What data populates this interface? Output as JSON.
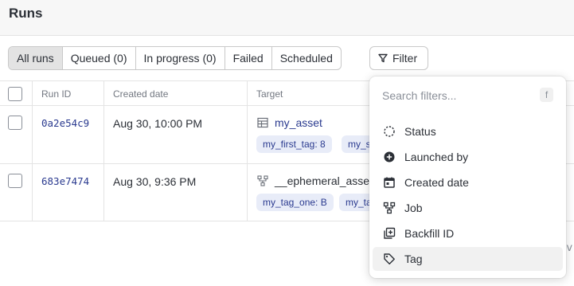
{
  "page": {
    "title": "Runs"
  },
  "tabs": [
    {
      "label": "All runs",
      "active": true
    },
    {
      "label": "Queued (0)",
      "active": false
    },
    {
      "label": "In progress (0)",
      "active": false
    },
    {
      "label": "Failed",
      "active": false
    },
    {
      "label": "Scheduled",
      "active": false
    }
  ],
  "filter_button": {
    "label": "Filter",
    "icon": "funnel-icon"
  },
  "table": {
    "columns": [
      "Run ID",
      "Created date",
      "Target"
    ],
    "rows": [
      {
        "run_id": "0a2e54c9",
        "created": "Aug 30, 10:00 PM",
        "target_icon": "table-icon",
        "target": "my_asset",
        "tags": [
          "my_first_tag: 8",
          "my_second_tag"
        ]
      },
      {
        "run_id": "683e7474",
        "created": "Aug 30, 9:36 PM",
        "target_icon": "job-icon",
        "target": "__ephemeral_asset_job__",
        "tags": [
          "my_tag_one: B",
          "my_tag_two"
        ]
      }
    ],
    "partial_text": "ev"
  },
  "filter_menu": {
    "search_placeholder": "Search filters...",
    "shortcut": "f",
    "items": [
      {
        "label": "Status",
        "icon": "status-dashed-circle-icon"
      },
      {
        "label": "Launched by",
        "icon": "plus-circle-icon"
      },
      {
        "label": "Created date",
        "icon": "calendar-icon"
      },
      {
        "label": "Job",
        "icon": "job-icon"
      },
      {
        "label": "Backfill ID",
        "icon": "backfill-icon"
      },
      {
        "label": "Tag",
        "icon": "tag-icon",
        "hovered": true
      }
    ]
  }
}
